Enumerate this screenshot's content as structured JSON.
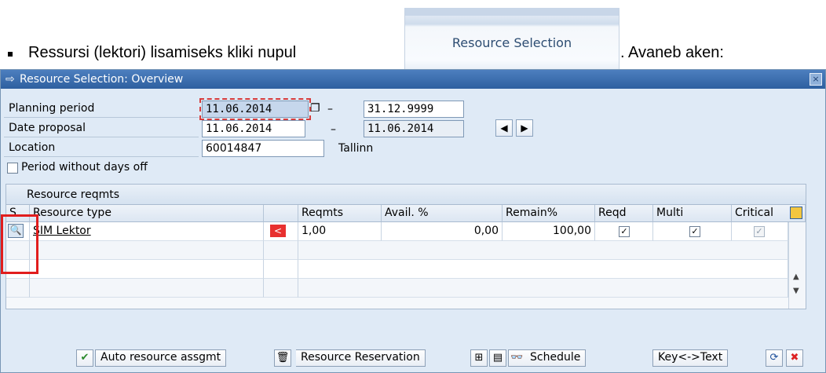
{
  "doc": {
    "text_before": "Ressursi (lektori) lisamiseks kliki nupul",
    "text_after": ". Avaneb aken:",
    "button_label": "Resource Selection"
  },
  "window": {
    "title": "Resource Selection: Overview",
    "close_label": "×"
  },
  "form": {
    "planning_period_label": "Planning period",
    "planning_from": "11.06.2014",
    "planning_to": "31.12.9999",
    "date_proposal_label": "Date proposal",
    "proposal_from": "11.06.2014",
    "proposal_to": "11.06.2014",
    "location_label": "Location",
    "location_code": "60014847",
    "location_name": "Tallinn",
    "period_without_days_off_label": "Period without days off",
    "dash": "–"
  },
  "table": {
    "title": "Resource reqmts",
    "headers": {
      "s": "S",
      "resource_type": "Resource type",
      "reqmts": "Reqmts",
      "avail": "Avail. %",
      "remain": "Remain%",
      "reqd": "Reqd",
      "multi": "Multi",
      "critical": "Critical"
    },
    "rows": [
      {
        "resource_type": "SIM Lektor",
        "reqmts": "1,00",
        "avail": "0,00",
        "remain": "100,00",
        "reqd": true,
        "multi": true,
        "critical": true
      }
    ]
  },
  "toolbar": {
    "auto_assign": "Auto resource assgmt",
    "reservation": "Resource Reservation",
    "schedule": "Schedule",
    "key_text": "Key<->Text"
  },
  "colors": {
    "title_bar": "#2e5f9f",
    "window_bg": "#dfeaf6",
    "highlight_red": "#e11d1d"
  }
}
